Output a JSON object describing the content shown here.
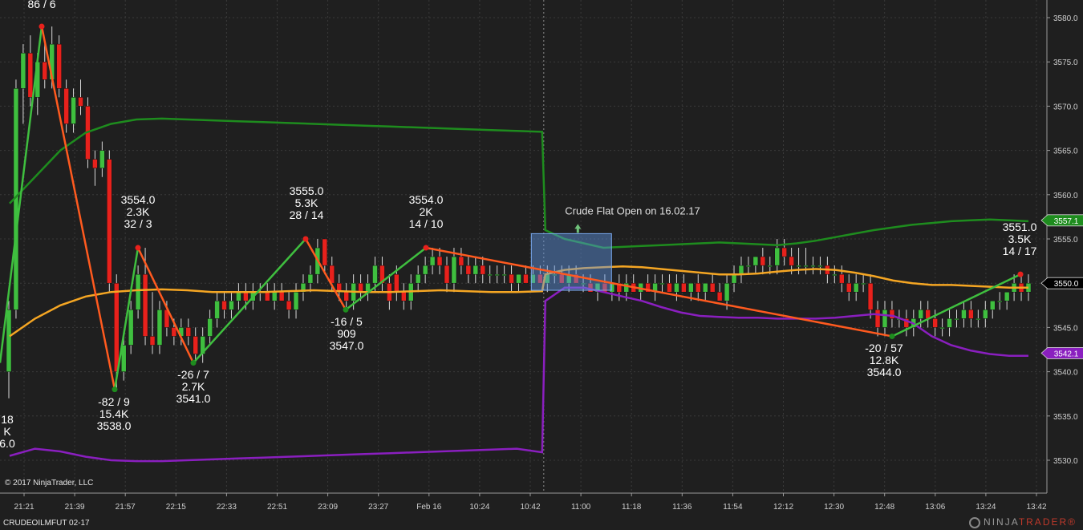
{
  "chart_data": {
    "type": "candlestick",
    "instrument": "CRUDEOILMFUT 02-17",
    "copyright": "© 2017 NinjaTrader, LLC",
    "brand_prefix": "NINJA",
    "brand_suffix": "TRADER",
    "brand_mark": "®",
    "ylim": [
      3526,
      3582
    ],
    "y_ticks": [
      3530.0,
      3535.0,
      3540.0,
      3545.0,
      3550.0,
      3555.0,
      3560.0,
      3565.0,
      3570.0,
      3575.0,
      3580.0
    ],
    "x_ticks": [
      "21:21",
      "21:39",
      "21:57",
      "22:15",
      "22:33",
      "22:51",
      "23:09",
      "23:27",
      "Feb 16",
      "10:24",
      "10:42",
      "11:00",
      "11:18",
      "11:36",
      "11:54",
      "12:12",
      "12:30",
      "12:48",
      "13:06",
      "13:24",
      "13:42"
    ],
    "session_break_index": 75,
    "candles": [
      {
        "o": 3540,
        "h": 3548,
        "l": 3537,
        "c": 3547
      },
      {
        "o": 3547,
        "h": 3573,
        "l": 3546,
        "c": 3572
      },
      {
        "o": 3572,
        "h": 3577,
        "l": 3568,
        "c": 3576
      },
      {
        "o": 3576,
        "h": 3578,
        "l": 3570,
        "c": 3571
      },
      {
        "o": 3571,
        "h": 3576,
        "l": 3569,
        "c": 3575
      },
      {
        "o": 3575,
        "h": 3577,
        "l": 3572,
        "c": 3573
      },
      {
        "o": 3573,
        "h": 3579,
        "l": 3572,
        "c": 3577
      },
      {
        "o": 3577,
        "h": 3578,
        "l": 3571,
        "c": 3572
      },
      {
        "o": 3572,
        "h": 3573,
        "l": 3567,
        "c": 3568
      },
      {
        "o": 3568,
        "h": 3572,
        "l": 3567,
        "c": 3571
      },
      {
        "o": 3571,
        "h": 3573,
        "l": 3569,
        "c": 3570
      },
      {
        "o": 3570,
        "h": 3571,
        "l": 3563,
        "c": 3564
      },
      {
        "o": 3564,
        "h": 3565,
        "l": 3561,
        "c": 3563
      },
      {
        "o": 3563,
        "h": 3566,
        "l": 3562,
        "c": 3565
      },
      {
        "o": 3564,
        "h": 3565,
        "l": 3549,
        "c": 3550
      },
      {
        "o": 3550,
        "h": 3551,
        "l": 3538,
        "c": 3540
      },
      {
        "o": 3540,
        "h": 3544,
        "l": 3539,
        "c": 3543
      },
      {
        "o": 3543,
        "h": 3548,
        "l": 3542,
        "c": 3547
      },
      {
        "o": 3547,
        "h": 3552,
        "l": 3546,
        "c": 3551
      },
      {
        "o": 3551,
        "h": 3554,
        "l": 3543,
        "c": 3544
      },
      {
        "o": 3544,
        "h": 3549,
        "l": 3542,
        "c": 3543
      },
      {
        "o": 3543,
        "h": 3548,
        "l": 3542,
        "c": 3547
      },
      {
        "o": 3547,
        "h": 3548,
        "l": 3544,
        "c": 3545
      },
      {
        "o": 3545,
        "h": 3546,
        "l": 3543,
        "c": 3544
      },
      {
        "o": 3544,
        "h": 3546,
        "l": 3543,
        "c": 3545
      },
      {
        "o": 3545,
        "h": 3546,
        "l": 3543,
        "c": 3544
      },
      {
        "o": 3544,
        "h": 3545,
        "l": 3541,
        "c": 3542
      },
      {
        "o": 3542,
        "h": 3545,
        "l": 3541,
        "c": 3544
      },
      {
        "o": 3544,
        "h": 3547,
        "l": 3543,
        "c": 3546
      },
      {
        "o": 3546,
        "h": 3549,
        "l": 3545,
        "c": 3548
      },
      {
        "o": 3548,
        "h": 3549,
        "l": 3546,
        "c": 3547
      },
      {
        "o": 3547,
        "h": 3549,
        "l": 3546,
        "c": 3548
      },
      {
        "o": 3548,
        "h": 3550,
        "l": 3547,
        "c": 3549
      },
      {
        "o": 3549,
        "h": 3550,
        "l": 3547,
        "c": 3548
      },
      {
        "o": 3548,
        "h": 3550,
        "l": 3547,
        "c": 3549
      },
      {
        "o": 3549,
        "h": 3550,
        "l": 3548,
        "c": 3549
      },
      {
        "o": 3549,
        "h": 3550,
        "l": 3548,
        "c": 3548
      },
      {
        "o": 3548,
        "h": 3550,
        "l": 3547,
        "c": 3549
      },
      {
        "o": 3549,
        "h": 3550,
        "l": 3548,
        "c": 3548
      },
      {
        "o": 3548,
        "h": 3549,
        "l": 3546,
        "c": 3547
      },
      {
        "o": 3547,
        "h": 3550,
        "l": 3546,
        "c": 3549
      },
      {
        "o": 3549,
        "h": 3551,
        "l": 3548,
        "c": 3550
      },
      {
        "o": 3550,
        "h": 3552,
        "l": 3549,
        "c": 3551
      },
      {
        "o": 3551,
        "h": 3555,
        "l": 3550,
        "c": 3554
      },
      {
        "o": 3555,
        "h": 3555,
        "l": 3551,
        "c": 3552
      },
      {
        "o": 3552,
        "h": 3553,
        "l": 3549,
        "c": 3550
      },
      {
        "o": 3550,
        "h": 3551,
        "l": 3548,
        "c": 3549
      },
      {
        "o": 3549,
        "h": 3550,
        "l": 3547,
        "c": 3548
      },
      {
        "o": 3548,
        "h": 3551,
        "l": 3547,
        "c": 3550
      },
      {
        "o": 3550,
        "h": 3551,
        "l": 3548,
        "c": 3549
      },
      {
        "o": 3549,
        "h": 3551,
        "l": 3548,
        "c": 3550
      },
      {
        "o": 3550,
        "h": 3553,
        "l": 3549,
        "c": 3552
      },
      {
        "o": 3552,
        "h": 3553,
        "l": 3549,
        "c": 3550
      },
      {
        "o": 3550,
        "h": 3551,
        "l": 3547,
        "c": 3548
      },
      {
        "o": 3551,
        "h": 3552,
        "l": 3548,
        "c": 3549
      },
      {
        "o": 3549,
        "h": 3550,
        "l": 3547,
        "c": 3548
      },
      {
        "o": 3548,
        "h": 3551,
        "l": 3547,
        "c": 3550
      },
      {
        "o": 3550,
        "h": 3552,
        "l": 3549,
        "c": 3551
      },
      {
        "o": 3551,
        "h": 3553,
        "l": 3550,
        "c": 3552
      },
      {
        "o": 3552,
        "h": 3554,
        "l": 3551,
        "c": 3553
      },
      {
        "o": 3553,
        "h": 3554,
        "l": 3551,
        "c": 3552
      },
      {
        "o": 3552,
        "h": 3553,
        "l": 3549,
        "c": 3550
      },
      {
        "o": 3550,
        "h": 3554,
        "l": 3549,
        "c": 3553
      },
      {
        "o": 3553,
        "h": 3554,
        "l": 3551,
        "c": 3552
      },
      {
        "o": 3552,
        "h": 3553,
        "l": 3550,
        "c": 3551
      },
      {
        "o": 3551,
        "h": 3553,
        "l": 3550,
        "c": 3552
      },
      {
        "o": 3552,
        "h": 3553,
        "l": 3550,
        "c": 3551
      },
      {
        "o": 3551,
        "h": 3552,
        "l": 3550,
        "c": 3551
      },
      {
        "o": 3551,
        "h": 3552,
        "l": 3550,
        "c": 3551
      },
      {
        "o": 3551,
        "h": 3552,
        "l": 3550,
        "c": 3551
      },
      {
        "o": 3551,
        "h": 3552,
        "l": 3549,
        "c": 3550
      },
      {
        "o": 3550,
        "h": 3551,
        "l": 3549,
        "c": 3551
      },
      {
        "o": 3551,
        "h": 3552,
        "l": 3550,
        "c": 3550
      },
      {
        "o": 3550,
        "h": 3552,
        "l": 3550,
        "c": 3551
      },
      {
        "o": 3551,
        "h": 3552,
        "l": 3550,
        "c": 3550
      },
      {
        "o": 3550,
        "h": 3552,
        "l": 3549,
        "c": 3551
      },
      {
        "o": 3551,
        "h": 3552,
        "l": 3550,
        "c": 3551
      },
      {
        "o": 3551,
        "h": 3552,
        "l": 3550,
        "c": 3550
      },
      {
        "o": 3550,
        "h": 3552,
        "l": 3549,
        "c": 3551
      },
      {
        "o": 3551,
        "h": 3552,
        "l": 3550,
        "c": 3550
      },
      {
        "o": 3550,
        "h": 3551,
        "l": 3549,
        "c": 3550
      },
      {
        "o": 3550,
        "h": 3551,
        "l": 3549,
        "c": 3549
      },
      {
        "o": 3549,
        "h": 3550,
        "l": 3548,
        "c": 3550
      },
      {
        "o": 3550,
        "h": 3551,
        "l": 3549,
        "c": 3549
      },
      {
        "o": 3549,
        "h": 3550,
        "l": 3548,
        "c": 3550
      },
      {
        "o": 3550,
        "h": 3551,
        "l": 3548,
        "c": 3549
      },
      {
        "o": 3549,
        "h": 3551,
        "l": 3548,
        "c": 3550
      },
      {
        "o": 3550,
        "h": 3551,
        "l": 3549,
        "c": 3549
      },
      {
        "o": 3549,
        "h": 3550,
        "l": 3548,
        "c": 3550
      },
      {
        "o": 3550,
        "h": 3551,
        "l": 3549,
        "c": 3549
      },
      {
        "o": 3549,
        "h": 3551,
        "l": 3548,
        "c": 3550
      },
      {
        "o": 3550,
        "h": 3551,
        "l": 3549,
        "c": 3550
      },
      {
        "o": 3550,
        "h": 3551,
        "l": 3549,
        "c": 3549
      },
      {
        "o": 3549,
        "h": 3551,
        "l": 3548,
        "c": 3550
      },
      {
        "o": 3550,
        "h": 3551,
        "l": 3549,
        "c": 3549
      },
      {
        "o": 3549,
        "h": 3550,
        "l": 3548,
        "c": 3550
      },
      {
        "o": 3550,
        "h": 3551,
        "l": 3548,
        "c": 3549
      },
      {
        "o": 3549,
        "h": 3550,
        "l": 3548,
        "c": 3550
      },
      {
        "o": 3550,
        "h": 3551,
        "l": 3549,
        "c": 3549
      },
      {
        "o": 3549,
        "h": 3550,
        "l": 3548,
        "c": 3548
      },
      {
        "o": 3548,
        "h": 3551,
        "l": 3547,
        "c": 3550
      },
      {
        "o": 3550,
        "h": 3552,
        "l": 3549,
        "c": 3551
      },
      {
        "o": 3551,
        "h": 3553,
        "l": 3550,
        "c": 3552
      },
      {
        "o": 3552,
        "h": 3553,
        "l": 3551,
        "c": 3552
      },
      {
        "o": 3552,
        "h": 3553,
        "l": 3551,
        "c": 3553
      },
      {
        "o": 3553,
        "h": 3554,
        "l": 3551,
        "c": 3552
      },
      {
        "o": 3552,
        "h": 3553,
        "l": 3551,
        "c": 3552
      },
      {
        "o": 3552,
        "h": 3555,
        "l": 3551,
        "c": 3554
      },
      {
        "o": 3554,
        "h": 3555,
        "l": 3552,
        "c": 3553
      },
      {
        "o": 3553,
        "h": 3554,
        "l": 3551,
        "c": 3552
      },
      {
        "o": 3552,
        "h": 3554,
        "l": 3551,
        "c": 3552
      },
      {
        "o": 3552,
        "h": 3554,
        "l": 3551,
        "c": 3552
      },
      {
        "o": 3552,
        "h": 3553,
        "l": 3551,
        "c": 3552
      },
      {
        "o": 3552,
        "h": 3553,
        "l": 3551,
        "c": 3552
      },
      {
        "o": 3552,
        "h": 3553,
        "l": 3550,
        "c": 3551
      },
      {
        "o": 3551,
        "h": 3552,
        "l": 3550,
        "c": 3551
      },
      {
        "o": 3551,
        "h": 3552,
        "l": 3549,
        "c": 3550
      },
      {
        "o": 3550,
        "h": 3551,
        "l": 3548,
        "c": 3549
      },
      {
        "o": 3549,
        "h": 3551,
        "l": 3548,
        "c": 3550
      },
      {
        "o": 3550,
        "h": 3551,
        "l": 3549,
        "c": 3550
      },
      {
        "o": 3550,
        "h": 3551,
        "l": 3546,
        "c": 3547
      },
      {
        "o": 3547,
        "h": 3548,
        "l": 3544,
        "c": 3545
      },
      {
        "o": 3545,
        "h": 3548,
        "l": 3544,
        "c": 3547
      },
      {
        "o": 3547,
        "h": 3548,
        "l": 3545,
        "c": 3546
      },
      {
        "o": 3546,
        "h": 3547,
        "l": 3545,
        "c": 3546
      },
      {
        "o": 3546,
        "h": 3547,
        "l": 3544,
        "c": 3545
      },
      {
        "o": 3545,
        "h": 3547,
        "l": 3544,
        "c": 3546
      },
      {
        "o": 3546,
        "h": 3548,
        "l": 3545,
        "c": 3547
      },
      {
        "o": 3547,
        "h": 3548,
        "l": 3545,
        "c": 3546
      },
      {
        "o": 3546,
        "h": 3547,
        "l": 3544,
        "c": 3545
      },
      {
        "o": 3545,
        "h": 3546,
        "l": 3544,
        "c": 3545
      },
      {
        "o": 3545,
        "h": 3547,
        "l": 3544,
        "c": 3546
      },
      {
        "o": 3546,
        "h": 3547,
        "l": 3545,
        "c": 3546
      },
      {
        "o": 3546,
        "h": 3548,
        "l": 3545,
        "c": 3547
      },
      {
        "o": 3547,
        "h": 3548,
        "l": 3545,
        "c": 3546
      },
      {
        "o": 3546,
        "h": 3547,
        "l": 3545,
        "c": 3546
      },
      {
        "o": 3546,
        "h": 3548,
        "l": 3545,
        "c": 3547
      },
      {
        "o": 3547,
        "h": 3548,
        "l": 3546,
        "c": 3548
      },
      {
        "o": 3548,
        "h": 3549,
        "l": 3547,
        "c": 3548
      },
      {
        "o": 3548,
        "h": 3549,
        "l": 3547,
        "c": 3549
      },
      {
        "o": 3549,
        "h": 3551,
        "l": 3548,
        "c": 3550
      },
      {
        "o": 3550,
        "h": 3551,
        "l": 3548,
        "c": 3549
      },
      {
        "o": 3549,
        "h": 3551,
        "l": 3548,
        "c": 3550
      }
    ],
    "overlays": [
      {
        "color": "#1e8c1e",
        "values": [
          3559,
          3562,
          3565,
          3567,
          3568,
          3568.5,
          3568.6,
          3568.5,
          3568.4,
          3568.3,
          3568.2,
          3568.1,
          3568.0,
          3567.9,
          3567.8,
          3567.7,
          3567.6,
          3567.5,
          3567.4,
          3567.3,
          3567.2,
          3567.1,
          3556,
          3555,
          3554.5,
          3554,
          3554.1,
          3554.2,
          3554.3,
          3554.4,
          3554.5,
          3554.6,
          3554.5,
          3554.4,
          3554.3,
          3554.5,
          3554.8,
          3555.2,
          3555.6,
          3556,
          3556.3,
          3556.6,
          3556.8,
          3557.0,
          3557.1,
          3557.2,
          3557.1,
          3557.0
        ]
      },
      {
        "color": "#f5a623",
        "values": [
          3544,
          3546,
          3547.5,
          3548.5,
          3549,
          3549.2,
          3549.3,
          3549.2,
          3549.0,
          3549.0,
          3549.0,
          3549.1,
          3549.2,
          3549.1,
          3549.0,
          3549.0,
          3549.1,
          3549.2,
          3549.1,
          3549.0,
          3549.0,
          3549.1,
          3551,
          3551.5,
          3551.7,
          3551.8,
          3551.9,
          3551.8,
          3551.6,
          3551.4,
          3551.2,
          3551.0,
          3551.0,
          3551.1,
          3551.3,
          3551.5,
          3551.6,
          3551.5,
          3551.2,
          3550.8,
          3550.3,
          3550.0,
          3549.8,
          3549.8,
          3549.7,
          3549.6,
          3549.5,
          3549.5
        ]
      },
      {
        "color": "#8a1fbf",
        "values": [
          3530.5,
          3531.3,
          3531,
          3530.4,
          3530.0,
          3529.9,
          3529.9,
          3530.0,
          3530.1,
          3530.2,
          3530.3,
          3530.4,
          3530.5,
          3530.6,
          3530.7,
          3530.8,
          3530.9,
          3531.0,
          3531.1,
          3531.2,
          3531.3,
          3530.9,
          3548,
          3549.5,
          3549.5,
          3549.0,
          3548.5,
          3548.0,
          3547.3,
          3546.7,
          3546.3,
          3546.2,
          3546.1,
          3546.1,
          3546.0,
          3546.0,
          3546.0,
          3546.1,
          3546.3,
          3546.5,
          3546.3,
          3545.5,
          3544.0,
          3543.0,
          3542.4,
          3542.0,
          3541.8,
          3541.8
        ]
      }
    ],
    "zigzag": {
      "up_color": "#3fbf3f",
      "down_color": "#ff5a1f",
      "points": [
        {
          "price": 3541
        },
        {
          "price": 3579
        },
        {
          "price": 3538
        },
        {
          "price": 3554
        },
        {
          "price": 3541
        },
        {
          "price": 3555
        },
        {
          "price": 3547
        },
        {
          "price": 3554
        },
        {
          "price": 3544
        },
        {
          "price": 3551
        }
      ]
    },
    "swing_labels": [
      {
        "lines": [
          "86 / 6"
        ]
      },
      {
        "lines": [
          "3554.0",
          "2.3K",
          "32 / 3"
        ]
      },
      {
        "lines": [
          "-82 / 9",
          "15.4K",
          "3538.0"
        ]
      },
      {
        "lines": [
          "-26 / 7",
          "2.7K",
          "3541.0"
        ]
      },
      {
        "lines": [
          "3555.0",
          "5.3K",
          "28 / 14"
        ]
      },
      {
        "lines": [
          "-16 / 5",
          "909",
          "3547.0"
        ]
      },
      {
        "lines": [
          "3554.0",
          "2K",
          "14 / 10"
        ]
      },
      {
        "lines": [
          "-20 / 57",
          "12.8K",
          "3544.0"
        ]
      },
      {
        "lines": [
          "3551.0",
          "3.5K",
          "14 / 17"
        ]
      },
      {
        "lines": [
          "18",
          "K",
          "6.0"
        ]
      }
    ],
    "annotation": {
      "text": "Crude Flat Open on 16.02.17"
    },
    "price_badges": [
      {
        "value": "3557.1",
        "color": "#1e8c1e",
        "text_color": "#ffffff"
      },
      {
        "value": "3550.0",
        "color": "#000000",
        "text_color": "#ffffff"
      },
      {
        "value": "3542.1",
        "color": "#8a1fbf",
        "text_color": "#ffffff"
      }
    ],
    "colors": {
      "background": "#1f1f1f",
      "grid": "#3a3a3a",
      "up_candle": "#3fbf3f",
      "down_candle": "#e8211c",
      "axis_text": "#cfcfcf",
      "box_fill": "rgba(95,150,230,0.45)",
      "box_stroke": "#7aa9ee"
    }
  }
}
